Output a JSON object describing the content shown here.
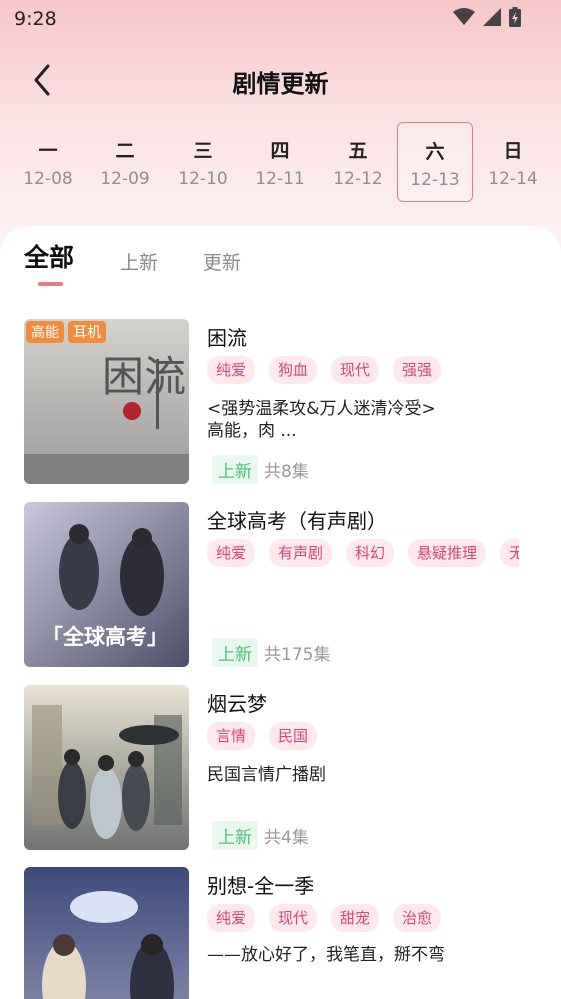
{
  "status_bar": {
    "time": "9:28"
  },
  "header": {
    "title": "剧情更新"
  },
  "days": [
    {
      "week": "一",
      "date": "12-08"
    },
    {
      "week": "二",
      "date": "12-09"
    },
    {
      "week": "三",
      "date": "12-10"
    },
    {
      "week": "四",
      "date": "12-11"
    },
    {
      "week": "五",
      "date": "12-12"
    },
    {
      "week": "六",
      "date": "12-13"
    },
    {
      "week": "日",
      "date": "12-14"
    }
  ],
  "selected_day": "12-13",
  "tabs": {
    "all": "全部",
    "new": "上新",
    "updated": "更新"
  },
  "items": [
    {
      "title": "困流",
      "badges": [
        "高能",
        "耳机"
      ],
      "tags": [
        "纯爱",
        "狗血",
        "现代",
        "强强"
      ],
      "desc": "<强势温柔攻&万人迷清冷受>\n高能，肉 ...",
      "status": "上新",
      "count": "共8集"
    },
    {
      "title": "全球高考（有声剧）",
      "badges": [],
      "tags": [
        "纯爱",
        "有声剧",
        "科幻",
        "悬疑推理",
        "无"
      ],
      "desc": "",
      "status": "上新",
      "count": "共175集"
    },
    {
      "title": "烟云梦",
      "badges": [],
      "tags": [
        "言情",
        "民国"
      ],
      "desc": "民国言情广播剧",
      "status": "上新",
      "count": "共4集"
    },
    {
      "title": "别想-全一季",
      "badges": [],
      "tags": [
        "纯爱",
        "现代",
        "甜宠",
        "治愈"
      ],
      "desc": "——放心好了，我笔直，掰不弯",
      "status": "",
      "count": ""
    }
  ],
  "covers": {
    "c1": {
      "text": "困流"
    },
    "c2": {
      "text": "「全球高考」"
    }
  }
}
